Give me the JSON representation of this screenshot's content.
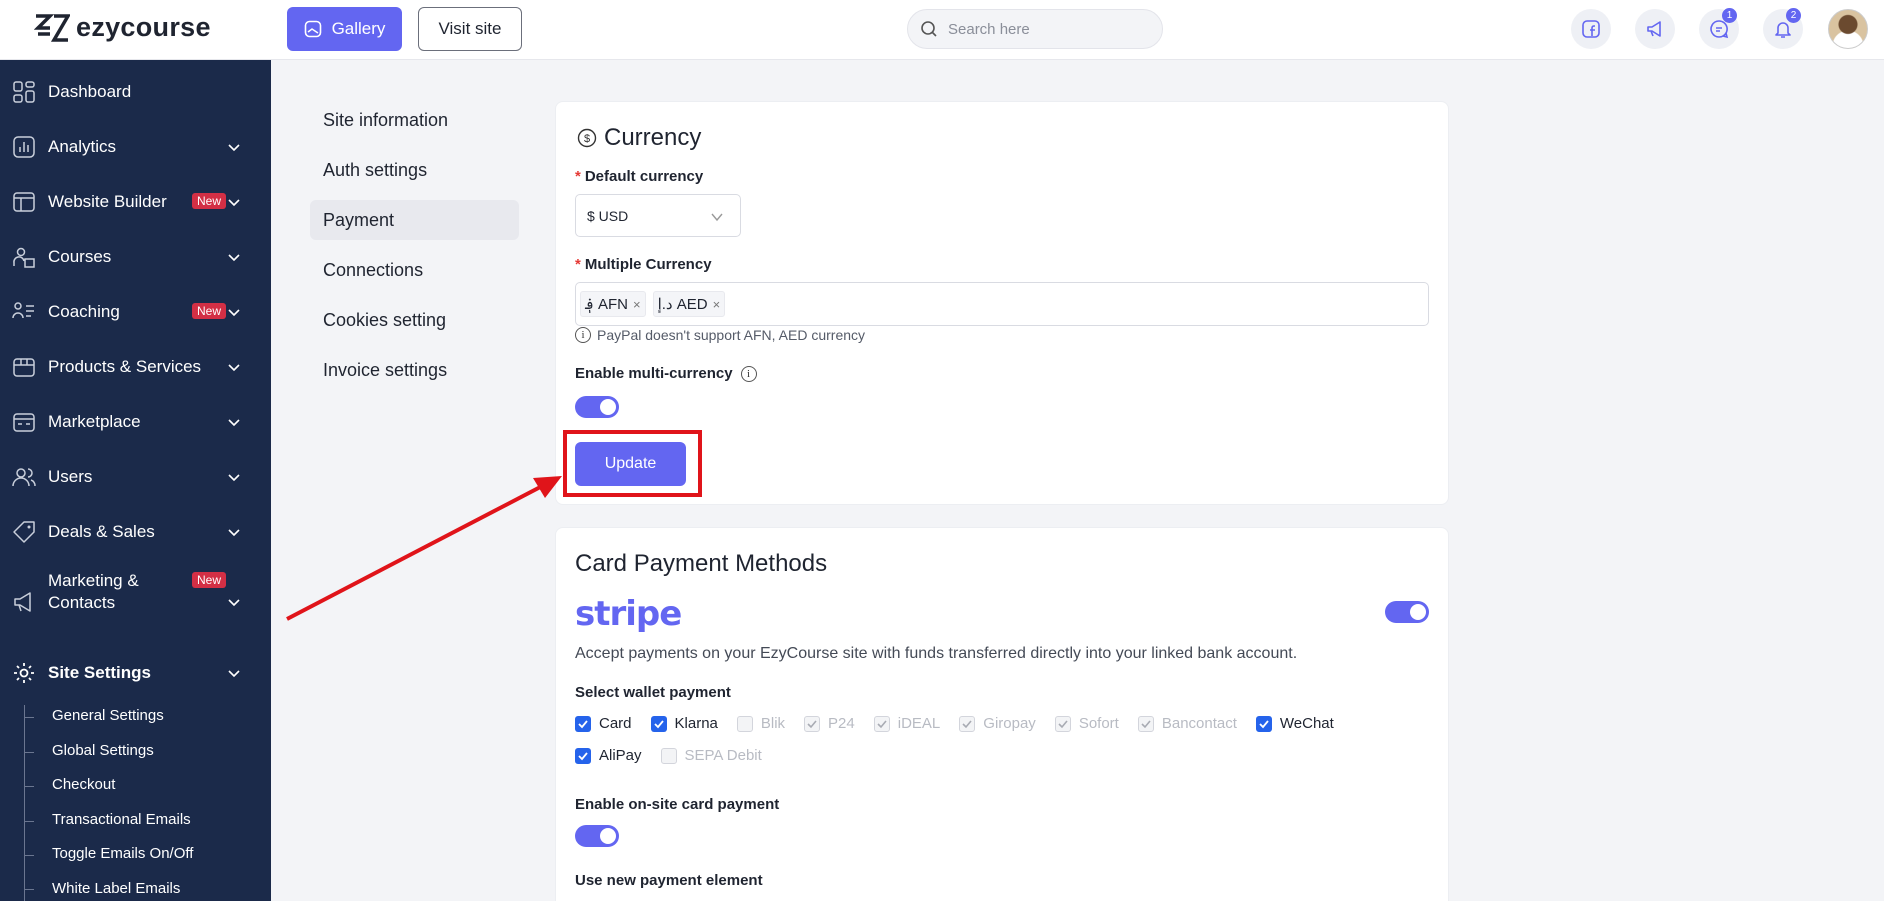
{
  "brand": {
    "name": "ezycourse"
  },
  "topbar": {
    "gallery_label": "Gallery",
    "visit_label": "Visit site",
    "search_placeholder": "Search here",
    "icons": [
      "facebook-icon",
      "megaphone-icon",
      "chat-icon",
      "bell-icon"
    ],
    "chat_badge": "1",
    "notification_badge": "2"
  },
  "sidebar": {
    "items": [
      {
        "label": "Dashboard",
        "icon": "dashboard-icon"
      },
      {
        "label": "Analytics",
        "icon": "analytics-icon"
      },
      {
        "label": "Website Builder",
        "icon": "website-builder-icon",
        "badge": "New"
      },
      {
        "label": "Courses",
        "icon": "courses-icon"
      },
      {
        "label": "Coaching",
        "icon": "coaching-icon",
        "badge": "New"
      },
      {
        "label": "Products & Services",
        "icon": "products-icon"
      },
      {
        "label": "Marketplace",
        "icon": "marketplace-icon"
      },
      {
        "label": "Users",
        "icon": "users-icon"
      },
      {
        "label": "Deals & Sales",
        "icon": "deals-icon"
      },
      {
        "label": "Marketing &",
        "label2": "Contacts",
        "icon": "marketing-icon",
        "badge": "New"
      },
      {
        "label": "Site Settings",
        "icon": "site-settings-icon"
      }
    ],
    "sub_items": [
      "General Settings",
      "Global Settings",
      "Checkout",
      "Transactional Emails",
      "Toggle Emails On/Off",
      "White Label Emails"
    ]
  },
  "settings_menu": [
    "Site information",
    "Auth settings",
    "Payment",
    "Connections",
    "Cookies setting",
    "Invoice settings"
  ],
  "currency": {
    "title": "Currency",
    "default_label": "Default currency",
    "default_value": "$ USD",
    "multiple_label": "Multiple Currency",
    "tags": [
      "؋ AFN",
      "د.إ AED"
    ],
    "hint": "PayPal doesn't support AFN, AED currency",
    "enable_label": "Enable multi-currency",
    "update_label": "Update"
  },
  "card_payment": {
    "title": "Card Payment Methods",
    "stripe": "stripe",
    "description": "Accept payments on your EzyCourse site with funds transferred directly into your linked bank account.",
    "wallet_label": "Select wallet payment",
    "wallets": [
      {
        "label": "Card",
        "state": "checked"
      },
      {
        "label": "Klarna",
        "state": "checked"
      },
      {
        "label": "Blik",
        "state": "unchecked-disabled"
      },
      {
        "label": "P24",
        "state": "checked-disabled"
      },
      {
        "label": "iDEAL",
        "state": "checked-disabled"
      },
      {
        "label": "Giropay",
        "state": "checked-disabled"
      },
      {
        "label": "Sofort",
        "state": "checked-disabled"
      },
      {
        "label": "Bancontact",
        "state": "checked-disabled"
      },
      {
        "label": "WeChat",
        "state": "checked"
      },
      {
        "label": "AliPay",
        "state": "checked"
      },
      {
        "label": "SEPA Debit",
        "state": "unchecked-disabled"
      }
    ],
    "onsite_label": "Enable on-site card payment",
    "new_element_label": "Use new payment element"
  },
  "colors": {
    "accent": "#6366f1",
    "sidebar": "#1b2a4a",
    "highlight": "#e0141a",
    "checkbox": "#2563eb"
  }
}
